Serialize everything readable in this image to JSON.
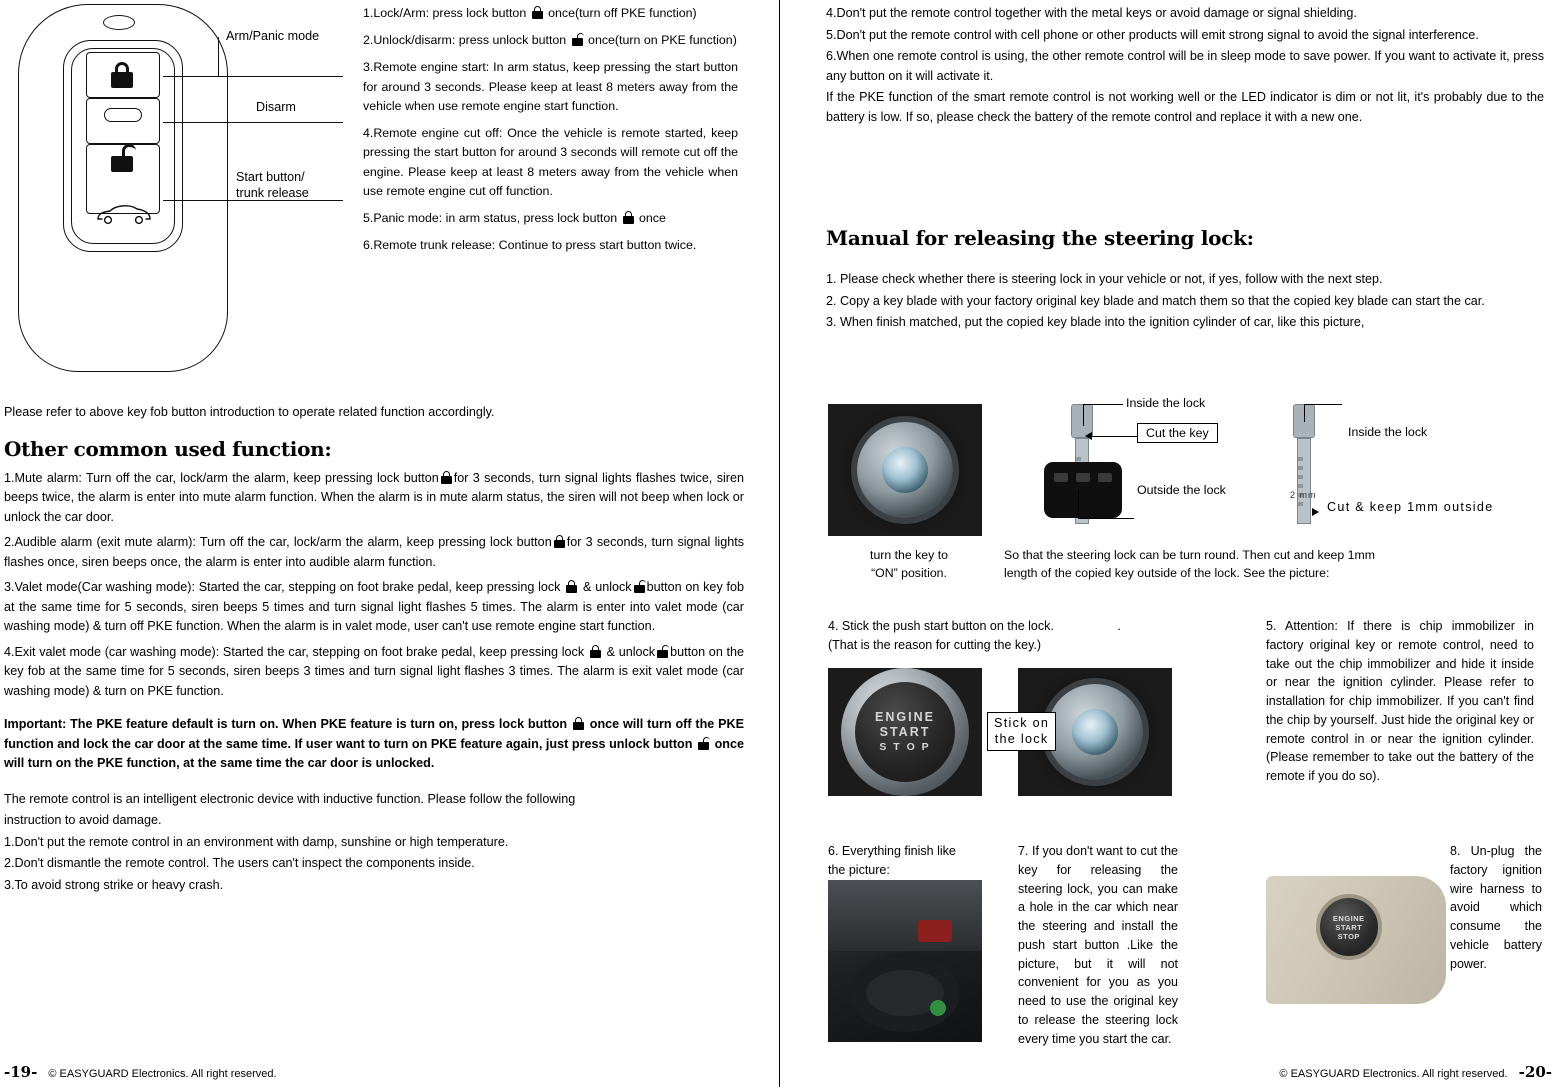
{
  "left": {
    "fob_labels": {
      "arm_panic": "Arm/Panic mode",
      "disarm": "Disarm",
      "start": "Start button/",
      "start2": "trunk release"
    },
    "functions": [
      "1.Lock/Arm: press lock button  once(turn off PKE function)",
      "2.Unlock/disarm: press unlock button  once(turn on PKE function)",
      "3.Remote engine start: In arm status, keep pressing the start button for around 3 seconds. Please keep at least 8 meters away from the vehicle when use remote engine start function.",
      "4.Remote engine cut off: Once the vehicle is remote started, keep pressing the start button for around 3 seconds will remote cut off the engine. Please keep at least 8 meters away from the vehicle when use remote engine cut off function.",
      "5.Panic mode: in arm status, press lock button  once",
      "6.Remote trunk release: Continue to press start button twice."
    ],
    "refer_note": "Please refer to above key fob button introduction to operate related function accordingly.",
    "section_title": "Other common used function:",
    "items": {
      "i1a": "1.Mute alarm: Turn off the car, lock/arm the alarm, keep pressing lock button",
      "i1b": "for 3 seconds, turn signal lights flashes twice, siren beeps twice, the alarm is enter into mute alarm function. When the alarm is in mute alarm status, the siren will not beep when lock or unlock the car door.",
      "i2a": "2.Audible alarm (exit mute alarm): Turn off the car, lock/arm the alarm, keep pressing lock button",
      "i2b": "for 3 seconds, turn signal lights flashes once, siren beeps once, the alarm is enter into audible alarm function.",
      "i3a": "3.Valet mode(Car washing mode): Started the car, stepping on foot brake pedal, keep pressing lock",
      "i3b": "&",
      "i3c": "unlock",
      "i3d": "button on key fob at the same time for 5 seconds, siren beeps 5 times and turn signal light flashes 5 times. The alarm is enter into valet mode (car washing mode) & turn off PKE function. When the alarm is in valet mode, user can't use remote engine start function.",
      "i4a": "4.Exit valet mode (car washing mode): Started the car, stepping on foot brake pedal, keep pressing lock",
      "i4b": "&",
      "i4c": "unlock",
      "i4d": "button on the key fob at the same time  for 5 seconds, siren beeps 3 times and turn signal light flashes 3 times. The alarm is exit valet mode (car washing mode) & turn on PKE function."
    },
    "important": {
      "a": "Important: The PKE feature default is turn on. When PKE feature is turn on, press lock button",
      "b": "once will turn off the PKE function and lock the car door at the same time. If user want to turn on PKE feature again, just press unlock button",
      "c": "once will turn on the PKE function, at the same time the car door is unlocked."
    },
    "closing": [
      "The remote control is an intelligent electronic device with inductive function. Please follow the following",
      "instruction to avoid damage.",
      "1.Don't put the remote control in an environment with damp, sunshine or high temperature.",
      "2.Don't dismantle the remote control. The users can't inspect the components inside.",
      "3.To avoid strong strike or heavy crash."
    ],
    "footer": {
      "page": "-19-",
      "copy": "©  EASYGUARD  Electronics.   All  right reserved."
    }
  },
  "right": {
    "notes": [
      "4.Don't put the remote control together with the metal keys or avoid damage or signal shielding.",
      "5.Don't put the remote control with cell phone or other products will emit strong signal to avoid the signal interference.",
      "6.When one remote control is using, the other remote control will be in sleep mode to save power. If you want to activate it, press any button on it will activate it.",
      "If the PKE function of the smart remote control is not working well or the LED indicator is dim or not lit, it's probably due to the battery is low. If so, please check the battery of the remote control and replace it with a new one."
    ],
    "section_title": "Manual for releasing the steering lock:",
    "steps": [
      "1. Please check whether there is steering lock in your vehicle or not, if yes, follow with the next step.",
      "2. Copy a key blade with your factory original key blade and match them so that the copied key blade can start the car.",
      "3. When finish matched, put the copied key blade into the ignition cylinder of car, like this picture,"
    ],
    "diagram": {
      "inside_lock_1": "Inside the lock",
      "cut_the_key": "Cut the key",
      "outside_lock": "Outside the lock",
      "inside_lock_2": "Inside the lock",
      "cut_keep": "Cut & keep 1mm outside",
      "key_mark": "2 mm",
      "cap_turn_1": "turn the key to",
      "cap_turn_2": "“ON” position.",
      "cap_so_1": "So that the steering lock can be turn round. Then cut and keep 1mm",
      "cap_so_2": "length of the copied key outside of the lock. See the picture:"
    },
    "step4": {
      "a": "4. Stick the push start button on the lock.",
      "dot": ".",
      "b": "(That is the reason for cutting the key.)",
      "stick1": "Stick on",
      "stick2": "the lock",
      "engine": "ENGINE",
      "start": "START",
      "stop": "S T O P"
    },
    "step5": "5. Attention: If there is chip immobilizer in factory original key or remote control, need to take out the chip immobilizer and hide it inside or near the ignition cylinder. Please refer to installation for chip immobilizer. If you can't find the chip by yourself. Just hide the original key or remote control in or near the ignition cylinder. (Please remember to take out the battery of the remote if you do so).",
    "step6_a": "6. Everything finish like",
    "step6_b": "the picture:",
    "step7": "7. If you don't want to cut the key for releasing the steering lock, you can make a hole in the car which near the steering and install the push start button .Like the picture, but it will not convenient for you as you need to use the original key to release the steering lock every time you start the car.",
    "step8": "8. Un-plug the factory ignition wire harness to avoid which consume the vehicle battery power.",
    "panel_engine": "ENGINE",
    "panel_start": "START",
    "panel_stop": "STOP",
    "footer": {
      "page": "-20-",
      "copy": "©  EASYGUARD  Electronics.   All  right reserved."
    }
  }
}
